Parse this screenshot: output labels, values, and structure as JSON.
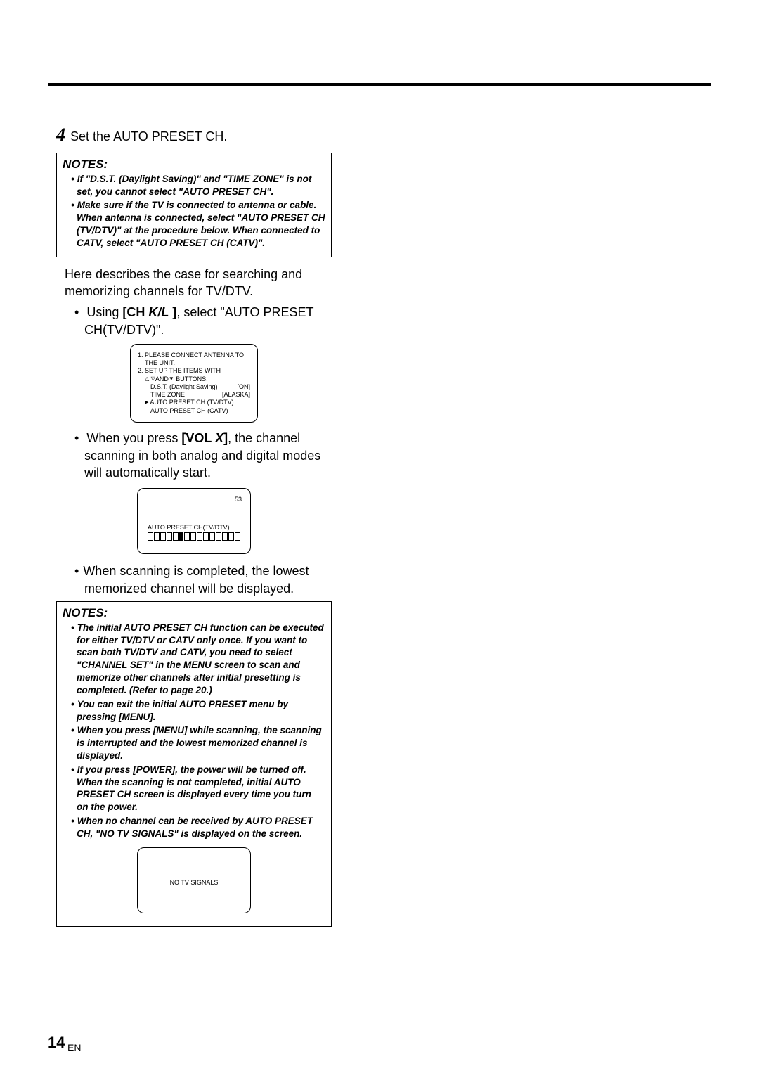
{
  "page": {
    "number": "14",
    "lang": "EN"
  },
  "step4": {
    "num": "4",
    "title": "Set the AUTO PRESET CH."
  },
  "notes1": {
    "heading": "NOTES:",
    "items": [
      "If \"D.S.T. (Daylight Saving)\" and \"TIME ZONE\" is not set, you cannot select \"AUTO PRESET CH\".",
      "Make sure if the TV is connected to antenna or cable. When antenna is connected, select \"AUTO PRESET CH (TV/DTV)\" at the procedure below.  When connected to CATV, select \"AUTO PRESET CH (CATV)\"."
    ]
  },
  "intro": "Here describes the case for searching and memorizing channels for TV/DTV.",
  "bullets": {
    "b1_pre": "Using ",
    "b1_bold": "[CH ",
    "b1_sym": "K/L",
    "b1_bold2": " ]",
    "b1_post": ", select \"AUTO PRESET CH(TV/DTV)\".",
    "b2_pre": "When you press ",
    "b2_bold": "[VOL ",
    "b2_sym": "X",
    "b2_bold2": "]",
    "b2_post": ", the channel scanning in both analog and digital modes will automatically start.",
    "b3": "When scanning is completed, the lowest memorized channel will be displayed."
  },
  "osd1": {
    "line1": "1. PLEASE CONNECT ANTENNA TO",
    "line1b": "THE UNIT.",
    "line2": "2. SET UP THE ITEMS WITH",
    "line2b_pre": "",
    "line2b_buttons": "AND",
    "line2b_post": " BUTTONS.",
    "dst_label": "D.S.T. (Daylight Saving)",
    "dst_val": "[ON]",
    "tz_label": "TIME ZONE",
    "tz_val": "[ALASKA]",
    "ap1": "AUTO PRESET CH (TV/DTV)",
    "ap2": "AUTO PRESET CH (CATV)"
  },
  "osd2": {
    "channel": "53",
    "label": "AUTO PRESET CH(TV/DTV)"
  },
  "notes2": {
    "heading": "NOTES:",
    "items": [
      "The initial AUTO PRESET CH function can be executed for either TV/DTV or CATV only once. If you want to scan both TV/DTV and CATV, you need to select \"CHANNEL SET\" in the MENU screen to scan and memorize other channels after initial presetting is completed. (Refer to page 20.)",
      "You can exit the initial AUTO PRESET menu by pressing [MENU].",
      "When you press [MENU] while scanning, the scanning is interrupted and the lowest memorized channel is displayed.",
      "If you press [POWER], the power will be turned off. When the scanning is not completed, initial AUTO PRESET CH screen is displayed every time you turn on the power.",
      "When no channel can be received by AUTO PRESET CH, \"NO TV SIGNALS\" is displayed on the screen."
    ]
  },
  "osd3": {
    "msg": "NO TV SIGNALS"
  }
}
